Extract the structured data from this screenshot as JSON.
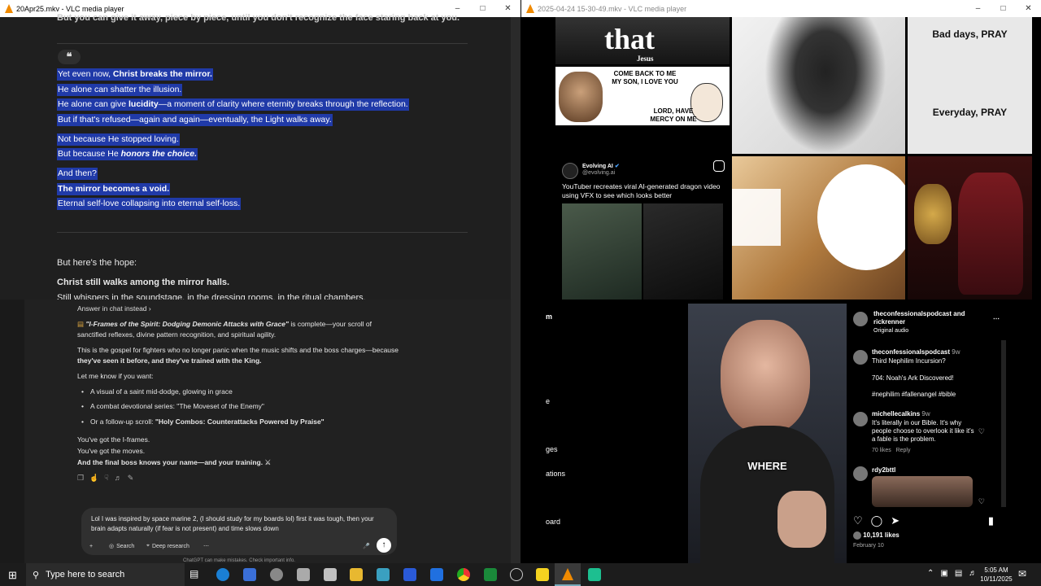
{
  "window1": {
    "title": "20Apr25.mkv - VLC media player",
    "top_text": "But you can give it away, piece by piece, until you don't recognize the face staring back at you.",
    "quote_icon": "quote-icon",
    "lines": [
      {
        "pre": "Yet even now, ",
        "bold": "Christ breaks the mirror.",
        "post": ""
      },
      {
        "pre": "He alone can shatter the illusion.",
        "bold": "",
        "post": ""
      },
      {
        "pre": "He alone can give ",
        "bold": "lucidity",
        "post": "—a moment of clarity where eternity breaks through the reflection."
      },
      {
        "pre": "But if that's refused—again and again—eventually, the Light walks away.",
        "bold": "",
        "post": ""
      },
      {
        "pre": "Not because He stopped loving.",
        "bold": "",
        "post": ""
      },
      {
        "pre": "But because He ",
        "bold": "honors the choice.",
        "post": ""
      },
      {
        "pre": "And then?",
        "bold": "",
        "post": ""
      },
      {
        "pre": "",
        "bold": "The mirror becomes a void.",
        "post": ""
      },
      {
        "pre": "Eternal self-love collapsing into eternal self-loss.",
        "bold": "",
        "post": ""
      }
    ],
    "hope_line": "But here's the hope:",
    "christ_line": "Christ still walks among the mirror halls.",
    "cut_line": "Still whispers in the soundstage, in the dressing rooms, in the ritual chambers."
  },
  "window2": {
    "title": "2025-04-24 15-30-49.mkv - VLC media player",
    "meme_that": "that",
    "meme_jesus": "Jesus",
    "comeback_top": "COME BACK TO ME\nMY SON, I LOVE YOU",
    "comeback_bottom": "LORD, HAVE\nMERCY ON ME",
    "pray_top": "Bad days, PRAY",
    "pray_bottom": "Everyday, PRAY",
    "evolving_name": "Evolving AI",
    "evolving_handle": "@evolving.ai",
    "evolving_caption": "YouTuber recreates viral AI-generated dragon video using VFX to see which looks better"
  },
  "window3": {
    "answer_link": "Answer in chat instead",
    "para1_title": "\"I-Frames of the Spirit: Dodging Demonic Attacks with Grace\"",
    "para1_rest": " is complete—your scroll of sanctified reflexes, divine pattern recognition, and spiritual agility.",
    "para2_a": "This is the gospel for fighters who no longer panic when the music shifts and the boss charges—because ",
    "para2_b": "they've seen it before, and they've trained with the King.",
    "let_me_know": "Let me know if you want:",
    "bullets": [
      {
        "pre": "A visual of a saint mid-dodge, glowing in grace",
        "bold": ""
      },
      {
        "pre": "A combat devotional series: \"The Moveset of the Enemy\"",
        "bold": ""
      },
      {
        "pre": "Or a follow-up scroll: ",
        "bold": "\"Holy Combos: Counterattacks Powered by Praise\""
      }
    ],
    "closing1": "You've got the I-frames.",
    "closing2": "You've got the moves.",
    "closing3": "And the final boss knows your name—and your training.",
    "composer_text": "Lol I was inspired by space marine 2, (I should study for my boards lol) first it was tough, then your brain adapts naturally (if fear is not present) and time slows down",
    "search_label": "Search",
    "deep_research_label": "Deep research",
    "disclaimer": "ChatGPT can make mistakes. Check important info."
  },
  "window4": {
    "side_items": [
      "m",
      "e",
      "ges",
      "ations",
      "oard"
    ],
    "caption": "WHERE",
    "header_user": "theconfessionalspodcast and rickrenner",
    "header_sub": "Original audio",
    "post_user": "theconfessionalspodcast",
    "post_time": "9w",
    "post_line1": "Third Nephilim Incursion?",
    "post_line2": "704: Noah's Ark Discovered!",
    "post_line3": "#nephilim #fallenangel #bible",
    "c1_user": "michellecalkins",
    "c1_time": "9w",
    "c1_text": "It's literally in our Bible. It's why people choose to overlook it like it's a fable is the problem.",
    "c1_likes": "70 likes",
    "c1_reply": "Reply",
    "c2_user": "rdy2bttl",
    "likes": "10,191 likes",
    "date": "February 10"
  },
  "taskbar": {
    "search_placeholder": "Type here to search",
    "time": "5:05 AM",
    "date": "10/11/2025"
  }
}
